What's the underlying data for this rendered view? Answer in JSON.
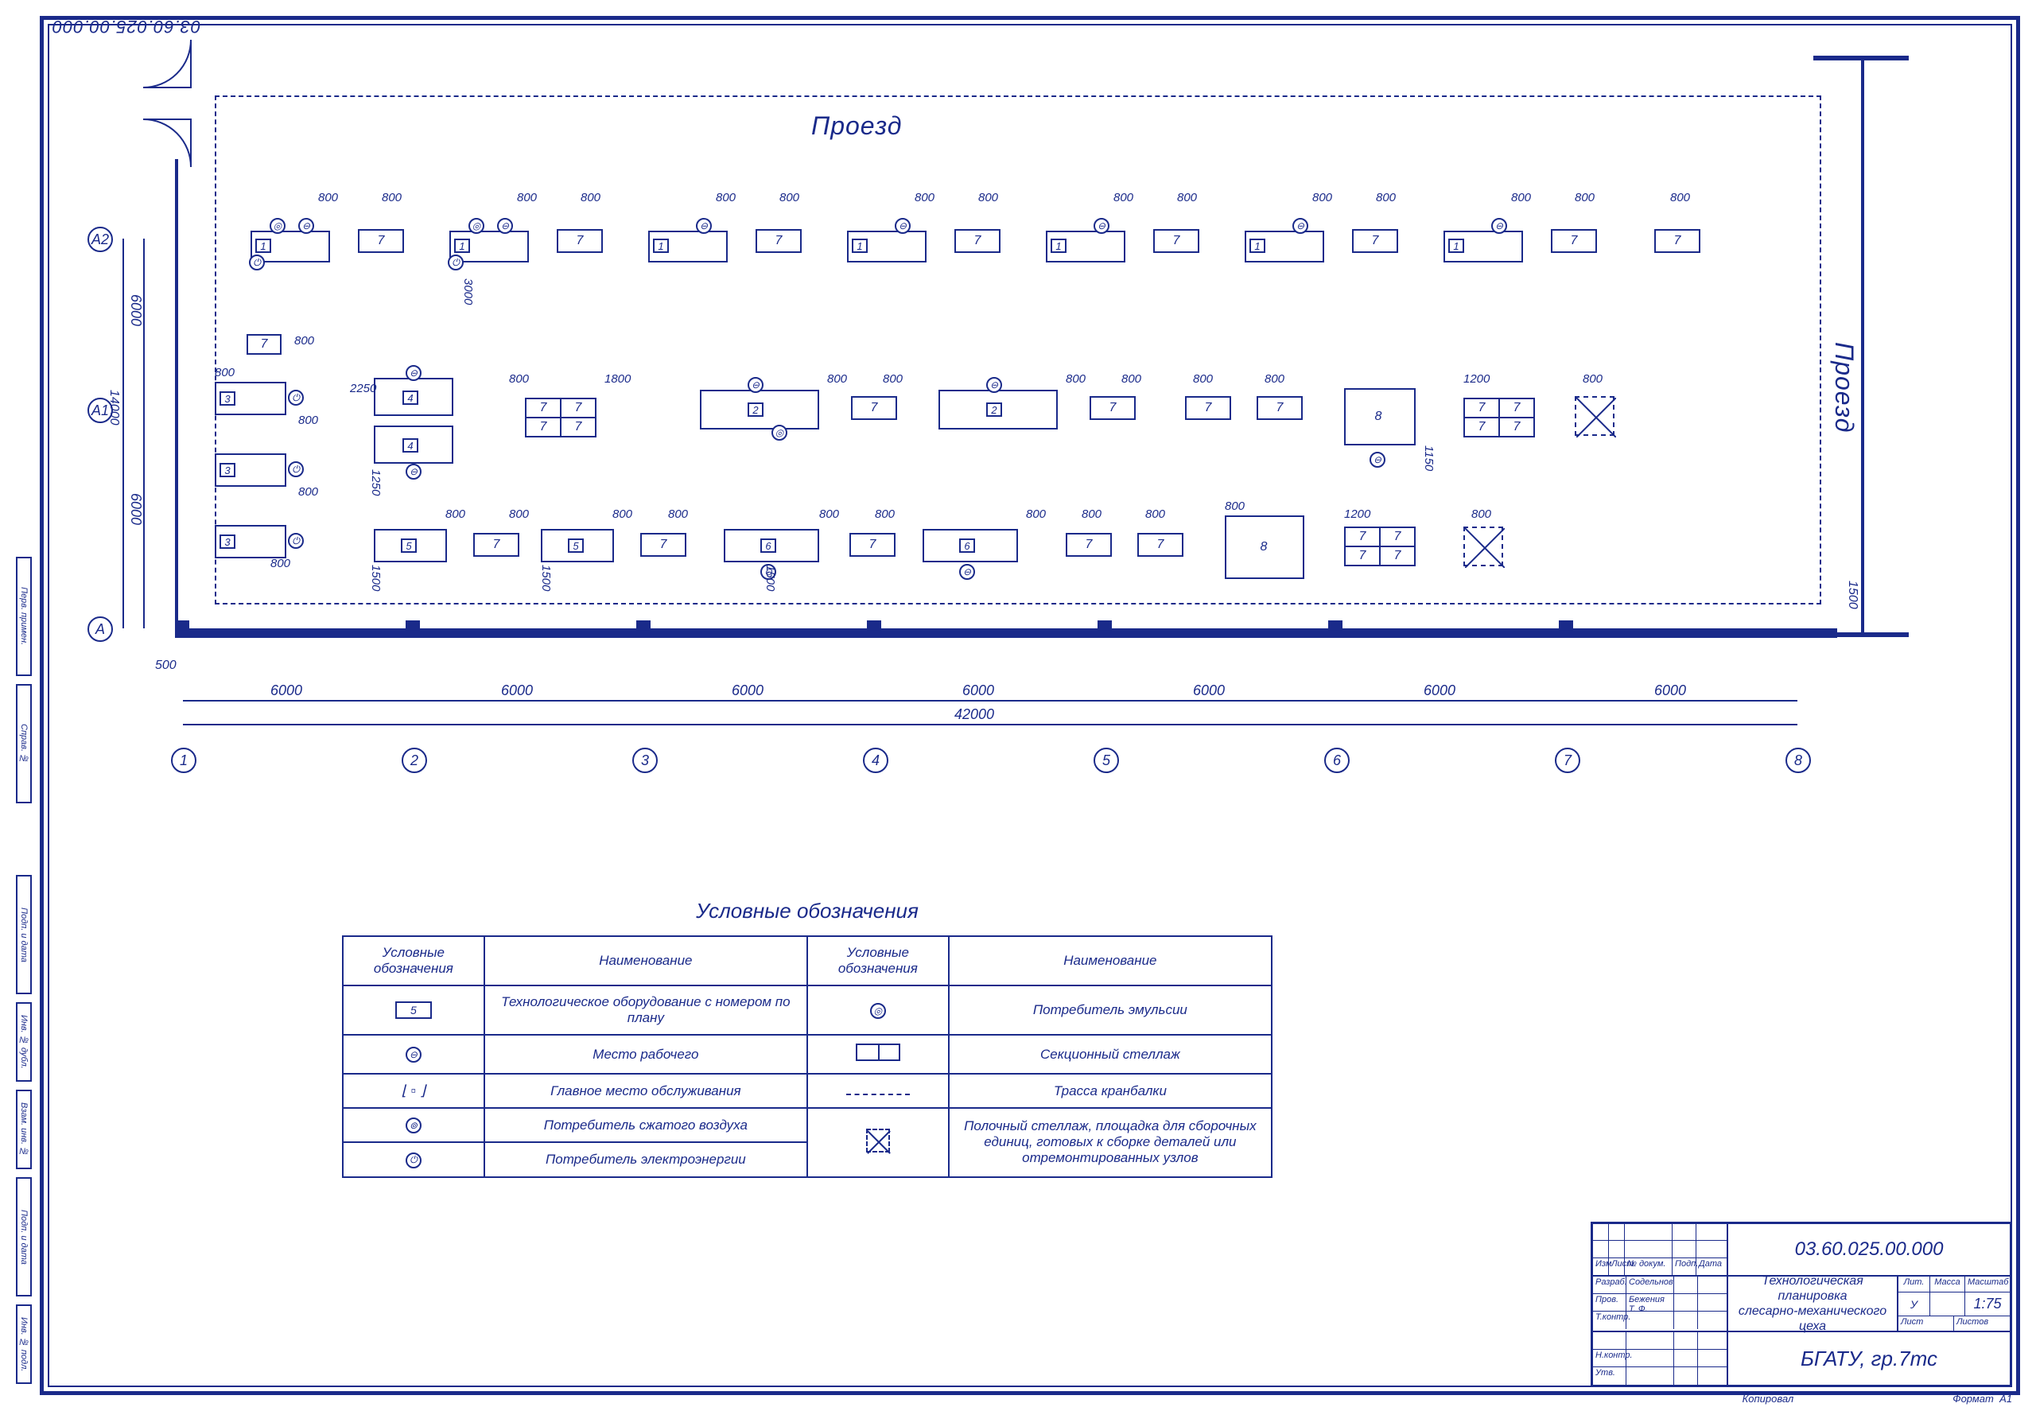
{
  "doc_number": "03.60.025.00.000",
  "plan_labels": {
    "passage_top": "Проезд",
    "passage_right": "Проезд"
  },
  "axes": {
    "rows": [
      "А",
      "А1",
      "А2"
    ],
    "cols": [
      "1",
      "2",
      "3",
      "4",
      "5",
      "6",
      "7",
      "8"
    ]
  },
  "dimensions": {
    "col_spans": [
      "6000",
      "6000",
      "6000",
      "6000",
      "6000",
      "6000",
      "6000"
    ],
    "total_width": "42000",
    "row_spans": [
      "6000",
      "6000"
    ],
    "row_subspan": "3000",
    "total_height": "14000",
    "left_offset": "500",
    "right_offset": "1500",
    "top_row_dims": [
      "800",
      "800",
      "800",
      "800",
      "800",
      "800",
      "800",
      "800",
      "800",
      "800",
      "800",
      "800",
      "800",
      "800",
      "800"
    ],
    "mid_row_dims": [
      "800",
      "800",
      "800",
      "800",
      "800",
      "2250",
      "1800",
      "800",
      "800",
      "1200",
      "800"
    ],
    "bot_row_dims": [
      "800",
      "1250",
      "1500",
      "800",
      "1500",
      "800",
      "800",
      "800",
      "1500",
      "800",
      "800",
      "800",
      "800",
      "800",
      "1150",
      "1200",
      "800"
    ]
  },
  "equipment_numbers": [
    "1",
    "2",
    "3",
    "4",
    "5",
    "6",
    "7",
    "8"
  ],
  "legend": {
    "title": "Условные обозначения",
    "headers": [
      "Условные обозначения",
      "Наименование",
      "Условные обозначения",
      "Наименование"
    ],
    "rows": [
      {
        "sym": "numbox",
        "sym_val": "5",
        "name": "Технологическое оборудование с номером по плану",
        "sym2": "emulsion",
        "name2": "Потребитель эмульсии"
      },
      {
        "sym": "worker",
        "name": "Место рабочего",
        "sym2": "rack",
        "name2": "Секционный стеллаж"
      },
      {
        "sym": "service",
        "name": "Главное место обслуживания",
        "sym2": "dashline",
        "name2": "Трасса кранбалки"
      },
      {
        "sym": "air",
        "name": "Потребитель сжатого воздуха",
        "sym2": "dashed-sq",
        "name2": "Полочный стеллаж, площадка для сборочных единиц, готовых к сборке деталей или отремонтированных узлов",
        "rowspan2": 2
      },
      {
        "sym": "elec",
        "name": "Потребитель электроэнергии"
      }
    ]
  },
  "title_block": {
    "doc_no": "03.60.025.00.000",
    "title_line1": "Технологическая планировка",
    "title_line2": "слесарно-механического цеха",
    "org": "БГАТУ, гр.7тс",
    "headers_top": [
      "Изм",
      "Лист",
      "№ докум.",
      "Подп.",
      "Дата"
    ],
    "roles": [
      {
        "role": "Разраб.",
        "name": "Содельнов"
      },
      {
        "role": "Пров.",
        "name": "Бежения Т. Ф."
      },
      {
        "role": "Т.контр.",
        "name": ""
      },
      {
        "role": "",
        "name": ""
      },
      {
        "role": "Н.контр.",
        "name": ""
      },
      {
        "role": "Утв.",
        "name": ""
      }
    ],
    "right_headers": [
      "Лит.",
      "Масса",
      "Масштаб"
    ],
    "scale": "1:75",
    "lit_val": "У",
    "sheet_labels": [
      "Лист",
      "Листов"
    ],
    "format_label": "Формат",
    "format_val": "А1",
    "copy_label": "Копировал"
  },
  "side_labels": [
    "Инв. № подл.",
    "Подп. и дата",
    "Взам. инв. №",
    "Инв. № дубл.",
    "Подп. и дата",
    "Справ. №",
    "Перв. примен."
  ]
}
